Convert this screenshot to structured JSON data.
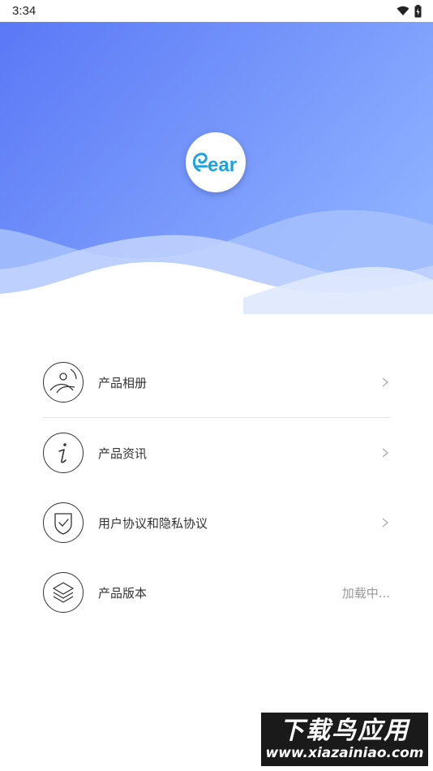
{
  "status_bar": {
    "time": "3:34"
  },
  "header": {
    "logo_text": "ear"
  },
  "menu": {
    "items": [
      {
        "label": "产品相册",
        "icon": "album-icon"
      },
      {
        "label": "产品资讯",
        "icon": "info-icon"
      },
      {
        "label": "用户协议和隐私协议",
        "icon": "shield-icon"
      },
      {
        "label": "产品版本",
        "icon": "layers-icon",
        "value": "加载中..."
      }
    ]
  },
  "watermark": {
    "title": "下载鸟应用",
    "url": "www.xiazainiao.com"
  },
  "colors": {
    "gradient_start": "#5b7cf7",
    "gradient_end": "#8fb2ff",
    "logo_blue": "#1aa3e0",
    "text": "#333333",
    "muted": "#999999"
  }
}
